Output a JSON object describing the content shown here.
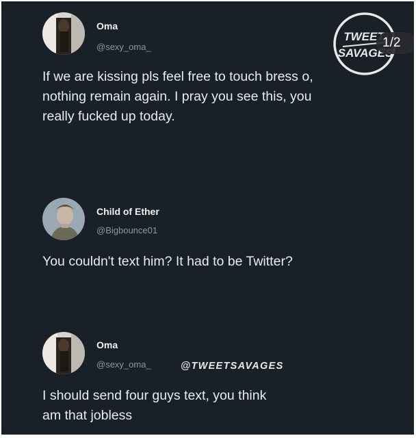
{
  "tweets": [
    {
      "name": "Oma",
      "handle": "@sexy_oma_",
      "lines": [
        "If we are kissing pls feel free to touch bress o,",
        "nothing remain again. I pray you see this, you",
        "really fucked up today."
      ]
    },
    {
      "name": "Child of Ether",
      "handle": "@Bigbounce01",
      "lines": [
        "You couldn't text him? It had to be Twitter?"
      ]
    },
    {
      "name": "Oma",
      "handle": "@sexy_oma_",
      "lines": [
        "I should send four guys text, you think",
        "am that jobless"
      ]
    }
  ],
  "watermark": {
    "handle": "@TWEETSAVAGES",
    "logo_line1": "TWEET",
    "logo_line2": "SAVAGES"
  },
  "pager": "1/2",
  "colors": {
    "background": "#1a2028",
    "text": "#e9ecef",
    "handle": "#8b98a5"
  }
}
